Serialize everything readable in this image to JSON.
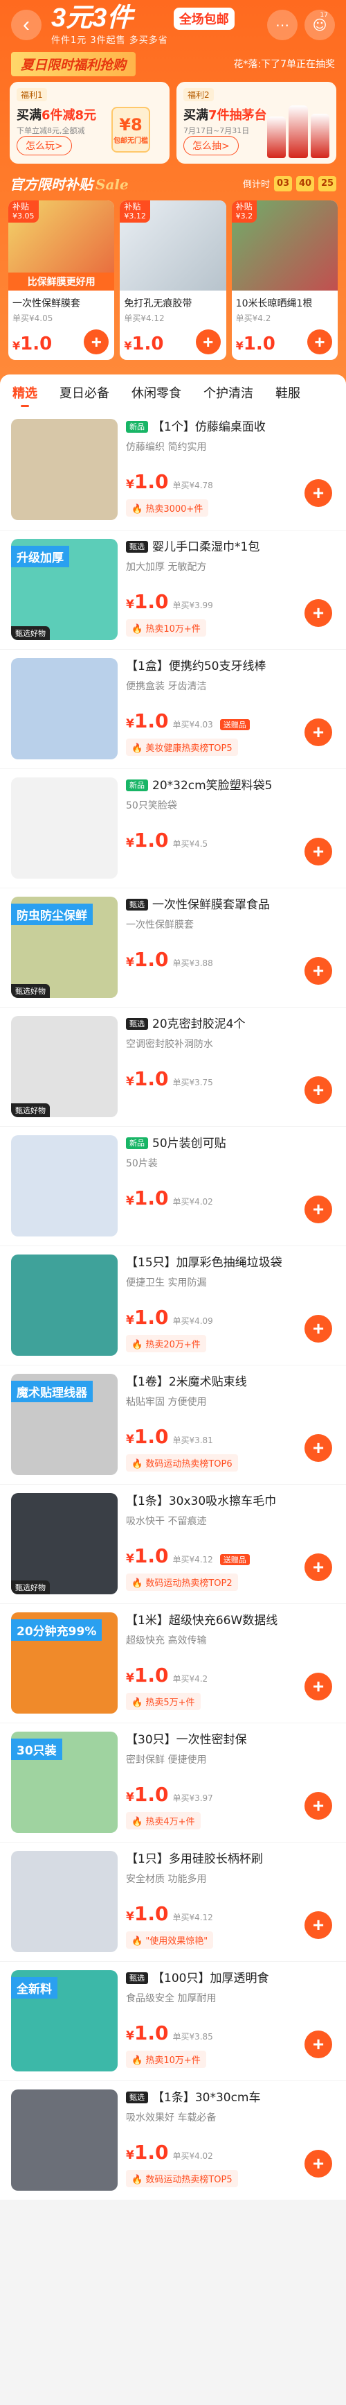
{
  "header": {
    "title": "3元3件",
    "subtitle": "件件1元  3件起售  多买多省",
    "mail_badge": "全场包邮",
    "icons": [
      "more-icon",
      "profile-icon"
    ],
    "notif_count": "17"
  },
  "banner": {
    "tag": "夏日限时福利抢购",
    "marquee": "花*落:下了7单正在抽奖"
  },
  "welfare": [
    {
      "tag": "福利1",
      "title_pre": "买满",
      "title_em": "6件减8元",
      "desc": "下单立减8元,全额减",
      "btn": "怎么玩>",
      "coin_value": "¥8",
      "coin_label": "包邮无门槛"
    },
    {
      "tag": "福利2",
      "title_pre": "买满",
      "title_em": "7件抽茅台",
      "desc": "7月17日~7月31日",
      "btn": "怎么抽>"
    }
  ],
  "subsidy": {
    "title": "官方限时补贴",
    "script": "Sale",
    "countdown_label": "倒计时",
    "hh": "03",
    "mm": "40",
    "ss": "25"
  },
  "deals": [
    {
      "chip": "补贴",
      "chip_sub": "¥3.05",
      "name": "一次性保鲜膜套",
      "orig": "单买¥4.05",
      "price": "1.0",
      "caption": "比保鲜膜更好用"
    },
    {
      "chip": "补贴",
      "chip_sub": "¥3.12",
      "name": "免打孔无痕胶带",
      "orig": "单买¥4.12",
      "price": "1.0"
    },
    {
      "chip": "补贴",
      "chip_sub": "¥3.2",
      "name": "10米长晾晒绳1根",
      "orig": "单买¥4.2",
      "price": "1.0"
    }
  ],
  "tabs": [
    "精选",
    "夏日必备",
    "休闲零食",
    "个护清洁",
    "鞋服"
  ],
  "items": [
    {
      "badge": "新品",
      "badge_type": "new",
      "title": "【1个】仿藤编桌面收",
      "sub": "仿藤编织 简约实用",
      "price": "1.0",
      "single": "单买¥4.78",
      "tag": "热卖3000+件",
      "thumb_bg": "#d7c7a8"
    },
    {
      "badge": "甄选",
      "badge_type": "sel",
      "title": "婴儿手口柔湿巾*1包",
      "sub": "加大加厚 无敏配方",
      "price": "1.0",
      "single": "单买¥3.99",
      "tag": "热卖10万+件",
      "thumb_bg": "#5ccdb8",
      "caption": "升级加厚",
      "overlay": "甄选好物"
    },
    {
      "badge": "",
      "badge_type": "",
      "title": "【1盒】便携约50支牙线棒",
      "sub": "便携盒装 牙齿清洁",
      "price": "1.0",
      "single": "单买¥4.03",
      "gift": "送赠品",
      "tag": "美妆健康热卖榜TOP5",
      "thumb_bg": "#b9d0ea"
    },
    {
      "badge": "新品",
      "badge_type": "new",
      "title": "20*32cm笑脸塑料袋5",
      "sub": "50只笑脸袋",
      "price": "1.0",
      "single": "单买¥4.5",
      "tag": "",
      "thumb_bg": "#f2f2f2"
    },
    {
      "badge": "甄选",
      "badge_type": "sel",
      "title": "一次性保鲜膜套罩食品",
      "sub": "一次性保鲜膜套",
      "price": "1.0",
      "single": "单买¥3.88",
      "tag": "",
      "thumb_bg": "#c8cf9a",
      "overlay": "甄选好物",
      "caption": "防虫防尘保鲜"
    },
    {
      "badge": "甄选",
      "badge_type": "sel",
      "title": "20克密封胶泥4个",
      "sub": "空调密封胶补洞防水",
      "price": "1.0",
      "single": "单买¥3.75",
      "tag": "",
      "thumb_bg": "#e2e2e2",
      "overlay": "甄选好物"
    },
    {
      "badge": "新品",
      "badge_type": "new",
      "title": "50片装创可贴",
      "sub": "50片装",
      "price": "1.0",
      "single": "单买¥4.02",
      "tag": "",
      "thumb_bg": "#d9e3f0"
    },
    {
      "badge": "",
      "badge_type": "",
      "title": "【15只】加厚彩色抽绳垃圾袋",
      "sub": "便捷卫生 实用防漏",
      "price": "1.0",
      "single": "单买¥4.09",
      "tag": "热卖20万+件",
      "thumb_bg": "#3fa29a"
    },
    {
      "badge": "",
      "badge_type": "",
      "title": "【1卷】2米魔术贴束线",
      "sub": "粘贴牢固 方便使用",
      "price": "1.0",
      "single": "单买¥3.81",
      "tag": "数码运动热卖榜TOP6",
      "thumb_bg": "#c9c9c9",
      "caption": "魔术贴理线器"
    },
    {
      "badge": "",
      "badge_type": "",
      "title": "【1条】30x30吸水擦车毛巾",
      "sub": "吸水快干 不留痕迹",
      "price": "1.0",
      "single": "单买¥4.12",
      "gift": "送赠品",
      "tag": "数码运动热卖榜TOP2",
      "thumb_bg": "#3a3f46",
      "overlay": "甄选好物"
    },
    {
      "badge": "",
      "badge_type": "",
      "title": "【1米】超级快充66W数据线",
      "sub": "超级快充 高效传输",
      "price": "1.0",
      "single": "单买¥4.2",
      "tag": "热卖5万+件",
      "thumb_bg": "#f08a2a",
      "caption": "20分钟充99%"
    },
    {
      "badge": "",
      "badge_type": "",
      "title": "【30只】一次性密封保",
      "sub": "密封保鲜 便捷使用",
      "price": "1.0",
      "single": "单买¥3.97",
      "tag": "热卖4万+件",
      "thumb_bg": "#9fd3a0",
      "caption": "30只装"
    },
    {
      "badge": "",
      "badge_type": "",
      "title": "【1只】多用硅胶长柄杯刷",
      "sub": "安全材质 功能多用",
      "price": "1.0",
      "single": "单买¥4.12",
      "tag": "\"使用效果惊艳\"",
      "thumb_bg": "#d6dbe3"
    },
    {
      "badge": "甄选",
      "badge_type": "sel",
      "title": "【100只】加厚透明食",
      "sub": "食品级安全 加厚耐用",
      "price": "1.0",
      "single": "单买¥3.85",
      "tag": "热卖10万+件",
      "thumb_bg": "#3cb8a8",
      "caption": "全新料"
    },
    {
      "badge": "甄选",
      "badge_type": "sel",
      "title": "【1条】30*30cm车",
      "sub": "吸水效果好 车载必备",
      "price": "1.0",
      "single": "单买¥4.02",
      "tag": "数码运动热卖榜TOP5",
      "thumb_bg": "#6b6f78"
    }
  ]
}
